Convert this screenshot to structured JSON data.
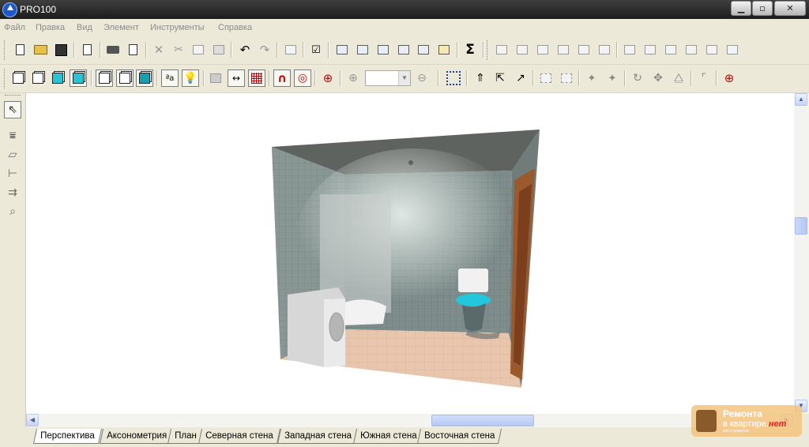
{
  "window": {
    "title": "PRO100"
  },
  "menu": {
    "items": [
      "Файл",
      "Правка",
      "Вид",
      "Элемент",
      "Инструменты",
      "Справка"
    ]
  },
  "toolbar1": {
    "icons": [
      "new-file-icon",
      "open-folder-icon",
      "save-icon",
      "edit-document-icon",
      "print-icon",
      "print-preview-icon",
      "delete-icon",
      "cut-icon",
      "copy-icon",
      "paste-icon",
      "undo-icon",
      "redo-icon",
      "properties-icon",
      "checklist-icon",
      "view-window-icon",
      "view-zoom-icon",
      "view-grid-icon",
      "view-dimension-icon",
      "view-export-icon",
      "view-stamp-icon",
      "sum-icon",
      "align-left-icon",
      "align-center-icon",
      "align-top-icon",
      "align-middle-icon",
      "stack-icon",
      "group-icon",
      "distribute-h-icon",
      "distribute-v-icon",
      "distribute-spacing-icon",
      "distribute-height-icon",
      "rotate-group-icon",
      "mirror-group-icon"
    ]
  },
  "toolbar2": {
    "icons": [
      "cube-wire-icon",
      "cube-outline-icon",
      "cube-shaded-icon",
      "cube-selected-icon",
      "box-view1-icon",
      "box-view2-icon",
      "box-solid-icon",
      "text-label-icon",
      "light-bulb-icon",
      "texture-icon",
      "dimension-icon",
      "grid-icon",
      "magnet-icon",
      "snap-icon",
      "target-icon",
      "zoom-in-icon",
      "zoom-out-icon",
      "select-all-icon",
      "move-up-icon",
      "move-arrow-icon",
      "pointer-rotate-icon",
      "frame-icon",
      "frame-resize-icon",
      "pin-icon",
      "pin-down-icon",
      "rotate-icon",
      "move-cross-icon",
      "mirror-icon",
      "corner-icon",
      "target-red-icon"
    ],
    "zoom_value": ""
  },
  "side_tools": {
    "icons": [
      "select-arrow-icon",
      "wall-tool-icon",
      "box-tool-icon",
      "align-tool-icon",
      "move-tool-icon",
      "zoom-tool-icon"
    ]
  },
  "tabs": [
    "Перспектива",
    "Аксонометрия",
    "План",
    "Северная стена",
    "Западная стена",
    "Южная стена",
    "Восточная стена"
  ],
  "active_tab": "Перспектива",
  "watermark": {
    "line1": "Ремонта",
    "line2": "в квартире.",
    "line2_accent": "нет",
    "line3": "всё о ремонте"
  },
  "scene": {
    "wall_color": "#7d8c8a",
    "floor_color": "#e6c4ac",
    "toilet_lid_color": "#22c6dd",
    "door_color": "#9a5a2e"
  }
}
